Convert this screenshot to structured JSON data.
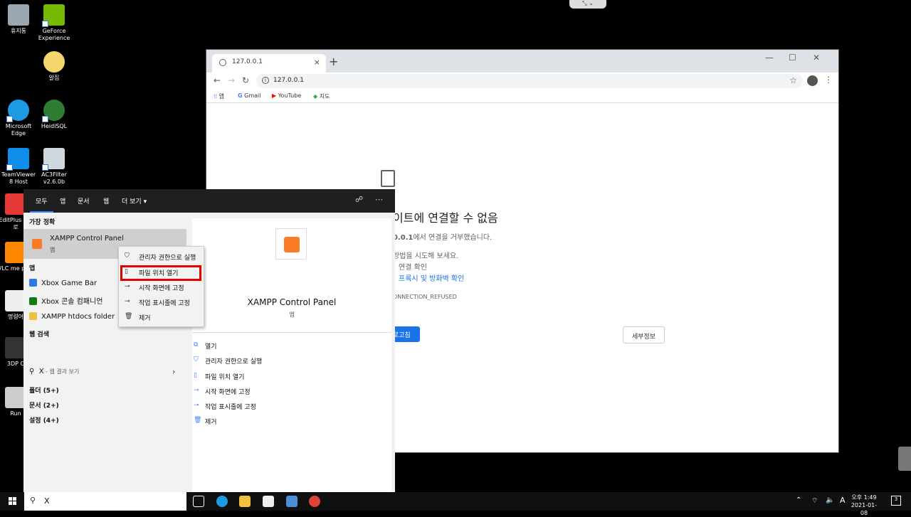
{
  "desktop": {
    "icons": [
      {
        "label": "휴지통",
        "icon": "recycle-bin-icon",
        "color": "#9aa7b0"
      },
      {
        "label": "GeForce Experience",
        "icon": "geforce-icon",
        "color": "#76b900"
      },
      {
        "label": "알집",
        "icon": "alzip-icon",
        "color": "#f5d76e"
      },
      {
        "label": "Microsoft Edge",
        "icon": "edge-icon",
        "color": "#1d9be0"
      },
      {
        "label": "HeidiSQL",
        "icon": "heidisql-icon",
        "color": "#2e7d32"
      },
      {
        "label": "TeamViewer 8 Host",
        "icon": "teamviewer-icon",
        "color": "#0e8ee9"
      },
      {
        "label": "AC3Filter v2.6.0b",
        "icon": "ac3filter-icon",
        "color": "#cfd8dc"
      },
      {
        "label": "EditPlus - 바로",
        "icon": "editplus-icon",
        "color": "#e53935"
      },
      {
        "label": "VLC me play",
        "icon": "vlc-icon",
        "color": "#ff8800"
      },
      {
        "label": "명령어",
        "icon": "cmd-icon",
        "color": "#eeeeee"
      },
      {
        "label": "3DP C",
        "icon": "3dp-icon",
        "color": "#333333"
      },
      {
        "label": "Run",
        "icon": "run-icon",
        "color": "#cccccc"
      }
    ]
  },
  "chrome": {
    "tab_title": "127.0.0.1",
    "url": "127.0.0.1",
    "bookmarks": [
      "앱",
      "Gmail",
      "YouTube",
      "지도"
    ],
    "error": {
      "title": "이트에 연결할 수 없음",
      "line1_bold": "0.0.1",
      "line1_rest": "에서 연결을 거부했습니다.",
      "line2": "방법을 시도해 보세요.",
      "line3": "연결 확인",
      "line4": "프록시 및 방화벽 확인",
      "code": "ONNECTION_REFUSED",
      "reload": "로고침",
      "details": "세부정보"
    }
  },
  "search_panel": {
    "tabs": [
      "모두",
      "앱",
      "문서",
      "웹",
      "더 보기"
    ],
    "left": {
      "best_match_heading": "가장 정확",
      "best_match_title": "XAMPP Control Panel",
      "best_match_type": "앱",
      "apps_heading": "앱",
      "apps": [
        "Xbox Game Bar",
        "Xbox 콘솔 컴패니언",
        "XAMPP htdocs folder"
      ],
      "web_heading": "웹 검색",
      "web_query": "X",
      "web_suffix": " - 웹 결과 보기",
      "folders": "폴더 (5+)",
      "documents": "문서 (2+)",
      "settings": "설정 (4+)"
    },
    "right": {
      "title": "XAMPP Control Panel",
      "type": "앱",
      "actions": [
        "열기",
        "관리자 권한으로 실행",
        "파일 위치 열기",
        "시작 화면에 고정",
        "작업 표시줄에 고정",
        "제거"
      ]
    }
  },
  "context_menu": {
    "items": [
      "관리자 권한으로 실행",
      "파일 위치 열기",
      "시작 화면에 고정",
      "작업 표시줄에 고정",
      "제거"
    ],
    "highlighted": "파일 위치 열기"
  },
  "taskbar": {
    "search_text": "X",
    "ime": "A",
    "time": "오후 1:49",
    "date": "2021-01-08",
    "notifications": "3"
  }
}
